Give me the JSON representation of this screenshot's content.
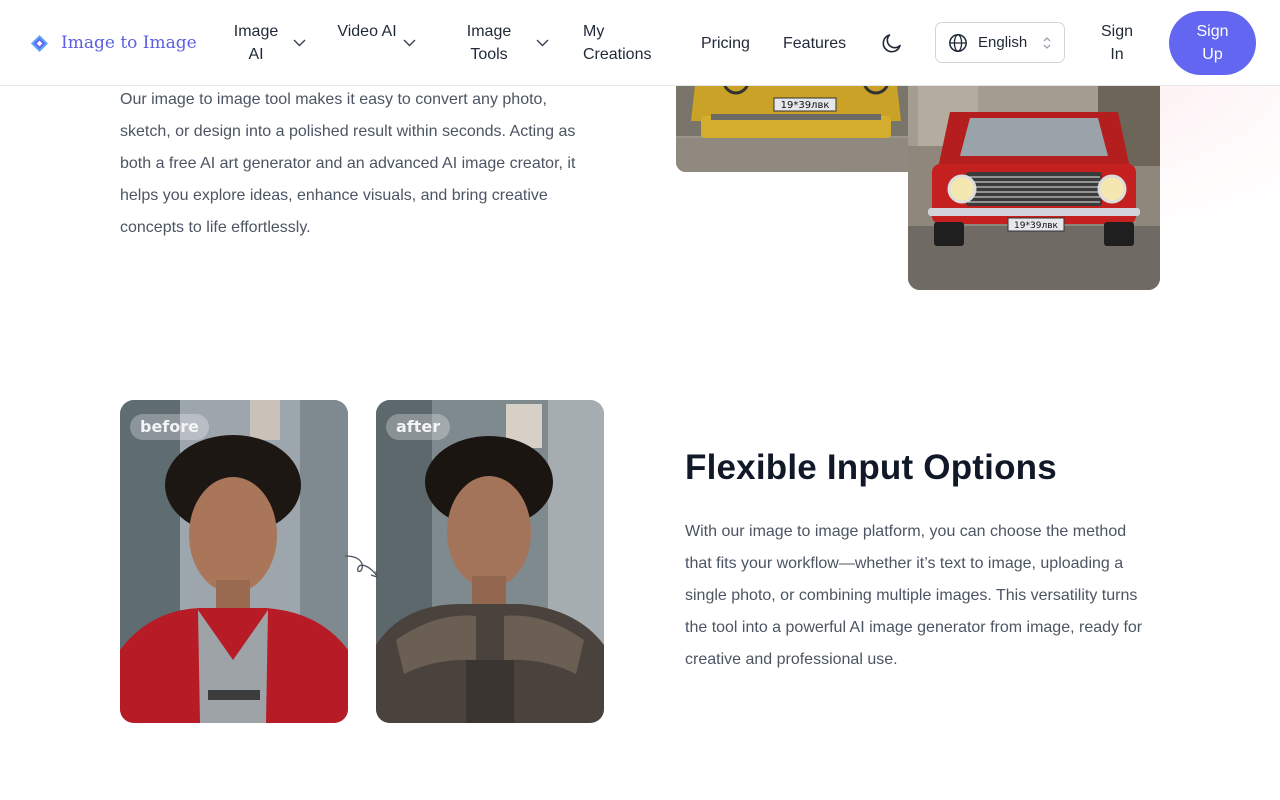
{
  "brand": {
    "name": "Image to Image",
    "logo_icon": "image-to-image-logo-icon",
    "accent": "#5b5fe0"
  },
  "nav": {
    "items": [
      {
        "label": "Image AI",
        "dropdown": true
      },
      {
        "label": "Video AI",
        "dropdown": true
      },
      {
        "label": "Image Tools",
        "dropdown": true
      },
      {
        "label": "My Creations",
        "dropdown": false
      },
      {
        "label": "Pricing",
        "dropdown": false
      },
      {
        "label": "Features",
        "dropdown": false
      }
    ],
    "theme_icon": "moon-icon",
    "language": {
      "selected": "English",
      "icon": "globe-icon"
    },
    "sign_in": "Sign In",
    "sign_up": "Sign Up",
    "sign_up_color": "#6366f1"
  },
  "section_intro": {
    "body": "Our image to image tool makes it easy to convert any photo, sketch, or design into a polished result within seconds. Acting as both a free AI art generator and an advanced AI image creator, it helps you explore ideas, enhance visuals, and bring creative concepts to life effortlessly.",
    "plate_text": "19*39лвк"
  },
  "section_flexible": {
    "title": "Flexible Input Options",
    "body": "With our image to image platform, you can choose the method that fits your workflow—whether it’s text to image, uploading a single photo, or combining multiple images. This versatility turns the tool into a powerful AI image generator from image, ready for creative and professional use.",
    "before_label": "before",
    "after_label": "after"
  }
}
